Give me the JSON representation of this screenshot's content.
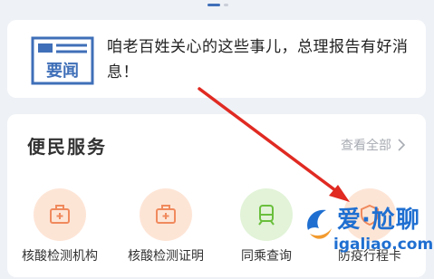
{
  "news": {
    "icon_label": "要闻",
    "text": "咱老百姓关心的这些事儿，总理报告有好消息！"
  },
  "services_section": {
    "title": "便民服务",
    "view_all": "查看全部",
    "items": [
      {
        "label": "核酸检测机构",
        "icon": "medical-kit-icon",
        "color": "#fde5d6",
        "icon_color": "#f08a5d"
      },
      {
        "label": "核酸检测证明",
        "icon": "medical-kit-icon",
        "color": "#fde5d6",
        "icon_color": "#f08a5d"
      },
      {
        "label": "同乘查询",
        "icon": "train-icon",
        "color": "#e2f3d8",
        "icon_color": "#6abf3c"
      },
      {
        "label": "防疫行程卡",
        "icon": "shield-icon",
        "color": "#fde5d6",
        "icon_color": "#f08a5d"
      }
    ]
  },
  "watermark": {
    "title": "爱·尬聊",
    "url": "igaliao.com"
  },
  "colors": {
    "accent": "#3f6fb8",
    "arrow": "#e02a22",
    "watermark": "#1f6fd1"
  }
}
